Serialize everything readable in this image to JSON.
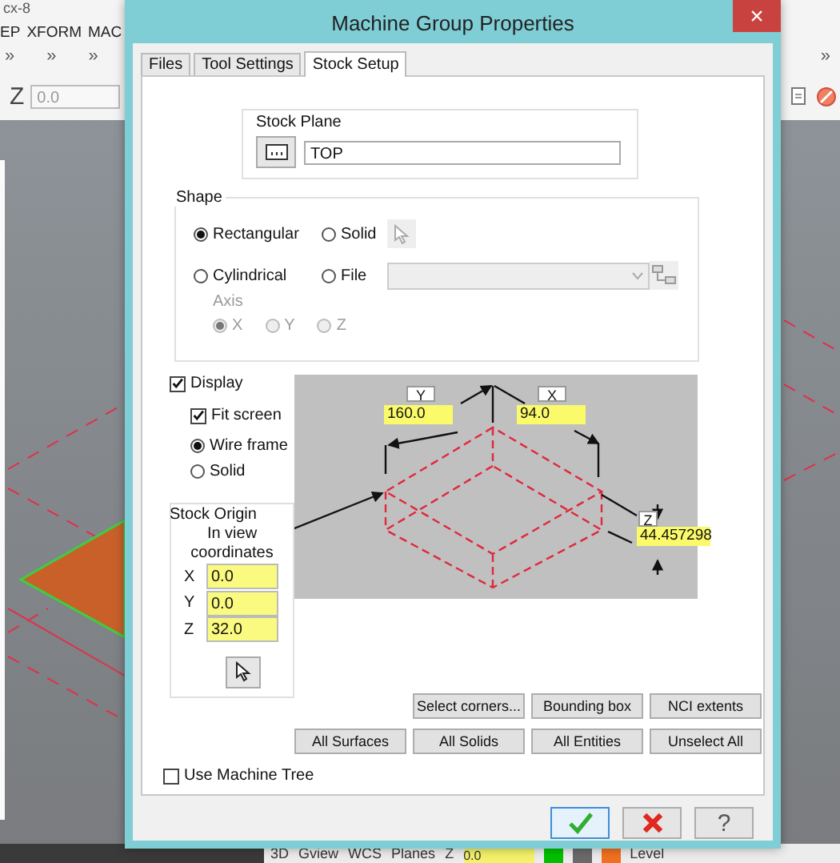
{
  "app": {
    "title": "cx-8",
    "menu": [
      "EP",
      "XFORM",
      "MAC"
    ],
    "toolbar_left": [
      "»",
      "»",
      "»"
    ],
    "toolbar_right": [
      "»"
    ],
    "z_label": "Z",
    "z_value": "0.0",
    "status_bar": {
      "items": [
        "3D",
        "Gview",
        "WCS",
        "Planes"
      ],
      "z_label": "Z",
      "z_value": "0.0",
      "swatches": [
        {
          "color": "#00c000"
        },
        {
          "color": "#6a6a6a"
        },
        {
          "color": "#f07020"
        }
      ],
      "level_label": "Level"
    }
  },
  "dialog": {
    "title": "Machine Group Properties",
    "close": "×",
    "tabs": [
      {
        "label": "Files",
        "selected": false
      },
      {
        "label": "Tool Settings",
        "selected": false
      },
      {
        "label": "Stock Setup",
        "selected": true
      }
    ],
    "stock_plane": {
      "title": "Stock Plane",
      "value": "TOP"
    },
    "shape": {
      "title": "Shape",
      "options": [
        {
          "label": "Rectangular",
          "selected": true
        },
        {
          "label": "Solid",
          "selected": false
        },
        {
          "label": "Cylindrical",
          "selected": false
        },
        {
          "label": "File",
          "selected": false
        }
      ],
      "axis": {
        "title": "Axis",
        "disabled": true,
        "options": [
          {
            "label": "X",
            "selected": true
          },
          {
            "label": "Y",
            "selected": false
          },
          {
            "label": "Z",
            "selected": false
          }
        ]
      }
    },
    "display": {
      "label": "Display",
      "checked": true
    },
    "fit_screen": {
      "label": "Fit screen",
      "checked": true
    },
    "render_modes": [
      {
        "label": "Wire frame",
        "selected": true
      },
      {
        "label": "Solid",
        "selected": false
      }
    ],
    "stock_origin": {
      "title": "Stock Origin",
      "caption": "In view coordinates",
      "coordinates": [
        {
          "axis": "X",
          "value": "0.0"
        },
        {
          "axis": "Y",
          "value": "0.0"
        },
        {
          "axis": "Z",
          "value": "32.0"
        }
      ]
    },
    "preview": {
      "y_label": "Y",
      "y_value": "160.0",
      "x_label": "X",
      "x_value": "94.0",
      "z_label": "Z",
      "z_value": "44.457298"
    },
    "selection_buttons": [
      "Select corners...",
      "Bounding box",
      "NCI extents"
    ],
    "entity_buttons": [
      "All Surfaces",
      "All Solids",
      "All Entities",
      "Unselect All"
    ],
    "use_machine_tree": {
      "label": "Use Machine Tree",
      "checked": false
    },
    "help": "?"
  }
}
